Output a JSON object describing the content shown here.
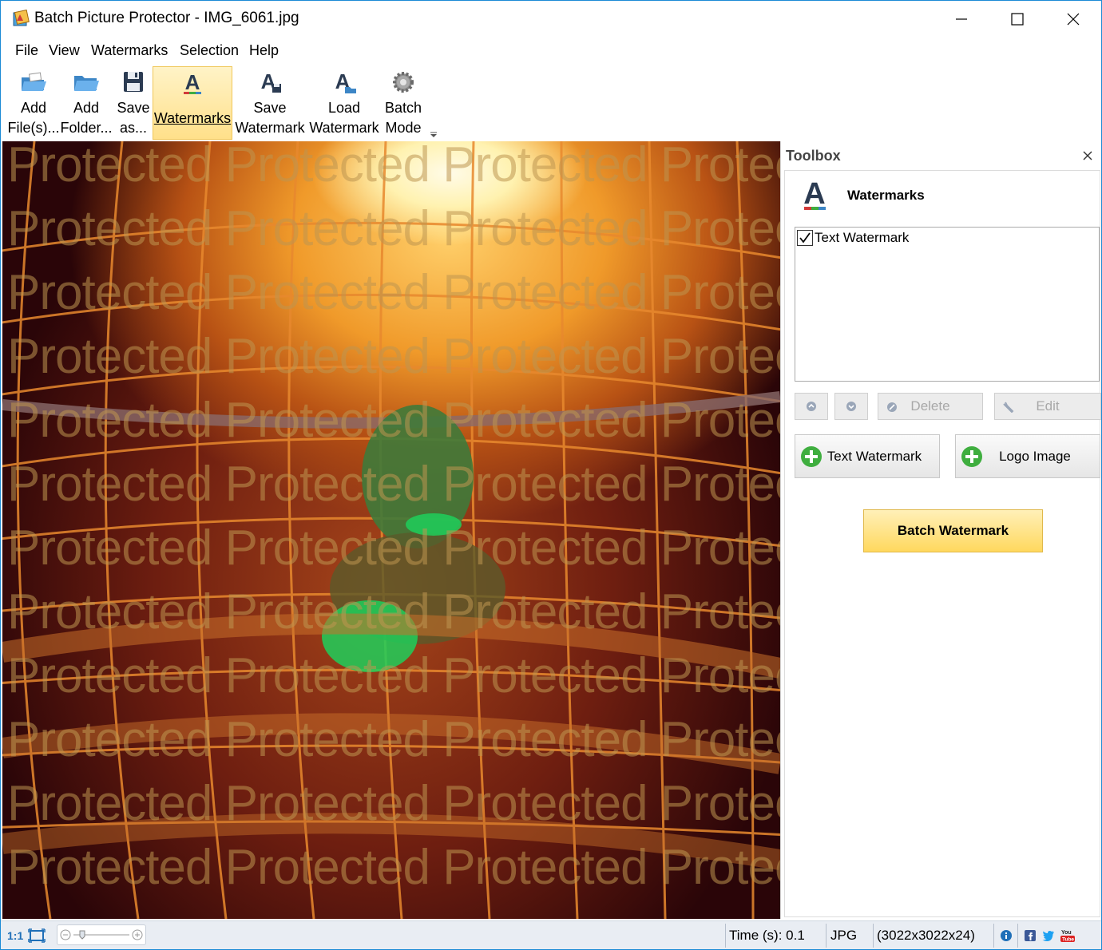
{
  "window": {
    "title": "Batch Picture Protector - IMG_6061.jpg"
  },
  "menu": {
    "items": [
      "File",
      "View",
      "Watermarks",
      "Selection",
      "Help"
    ]
  },
  "toolbar": {
    "add_files": "Add\nFile(s)...",
    "add_folder": "Add\nFolder...",
    "save_as": "Save\nas...",
    "watermarks": "Watermarks",
    "save_watermark": "Save\nWatermark",
    "load_watermark": "Load\nWatermark",
    "batch_mode": "Batch\nMode"
  },
  "image": {
    "watermark_text": "Protected",
    "watermark_rows": 12,
    "watermark_color": "#be9650"
  },
  "toolbox": {
    "title": "Toolbox",
    "section_title": "Watermarks",
    "list": [
      {
        "label": "Text Watermark",
        "checked": true
      }
    ],
    "delete_label": "Delete",
    "edit_label": "Edit",
    "add_text_label": "Text Watermark",
    "add_logo_label": "Logo Image",
    "batch_label": "Batch Watermark"
  },
  "status": {
    "zoom_label": "1:1",
    "time": "Time (s): 0.1",
    "format": "JPG",
    "dimensions": "(3022x3022x24)"
  },
  "colors": {
    "accent_active": "#ffe08a",
    "batch_button": "#ffd85e",
    "window_border": "#1c8bd6",
    "add_icon_green": "#3fae3f"
  }
}
